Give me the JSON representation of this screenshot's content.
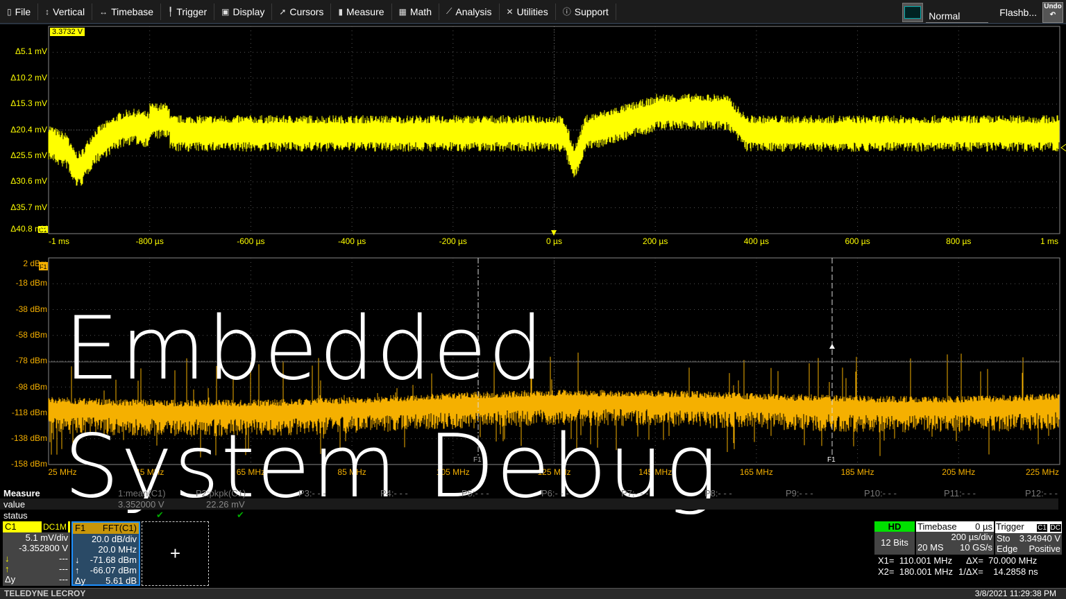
{
  "menu": [
    {
      "label": "File",
      "icon": "file-icon",
      "glyph": "▯"
    },
    {
      "label": "Vertical",
      "icon": "vertical-arrows-icon",
      "glyph": "↕"
    },
    {
      "label": "Timebase",
      "icon": "horizontal-arrows-icon",
      "glyph": "↔"
    },
    {
      "label": "Trigger",
      "icon": "trigger-icon",
      "glyph": "╿"
    },
    {
      "label": "Display",
      "icon": "display-icon",
      "glyph": "▣"
    },
    {
      "label": "Cursors",
      "icon": "cursor-icon",
      "glyph": "➚"
    },
    {
      "label": "Measure",
      "icon": "measure-icon",
      "glyph": "▮"
    },
    {
      "label": "Math",
      "icon": "calculator-icon",
      "glyph": "▦"
    },
    {
      "label": "Analysis",
      "icon": "chart-icon",
      "glyph": "⟋"
    },
    {
      "label": "Utilities",
      "icon": "tools-icon",
      "glyph": "✕"
    },
    {
      "label": "Support",
      "icon": "info-icon",
      "glyph": "ⓘ"
    }
  ],
  "toolbar": {
    "display_mode": "Normal",
    "flashback": "Flashb...",
    "undo": "Undo"
  },
  "colors": {
    "c1": "#ffff00",
    "f1": "#f5b000",
    "hd": "#00e000"
  },
  "top_plot": {
    "marker_value": "3.3732 V",
    "y_labels": [
      "Δ5.1 mV",
      "Δ10.2 mV",
      "Δ15.3 mV",
      "Δ20.4 mV",
      "Δ25.5 mV",
      "Δ30.6 mV",
      "Δ35.7 mV",
      "Δ40.8 mV"
    ],
    "x_labels": [
      "-1 ms",
      "-800 µs",
      "-600 µs",
      "-400 µs",
      "-200 µs",
      "0 µs",
      "200 µs",
      "400 µs",
      "600 µs",
      "800 µs",
      "1 ms"
    ],
    "channel_tag": "C1"
  },
  "bottom_plot": {
    "y_labels": [
      "2 dBm",
      "-18 dBm",
      "-38 dBm",
      "-58 dBm",
      "-78 dBm",
      "-98 dBm",
      "-118 dBm",
      "-138 dBm",
      "-158 dBm"
    ],
    "x_labels": [
      "25 MHz",
      "45 MHz",
      "65 MHz",
      "85 MHz",
      "105 MHz",
      "125 MHz",
      "145 MHz",
      "165 MHz",
      "185 MHz",
      "205 MHz",
      "225 MHz"
    ],
    "channel_tag": "F1",
    "cursor1_label": "F1",
    "cursor2_label": "F1"
  },
  "measure": {
    "title": "Measure",
    "row_value": "value",
    "row_status": "status",
    "params": [
      "1:mean(C1)",
      "P2:pkpk(C1)",
      "P3:- - -",
      "P4:- - -",
      "P5:- - -",
      "P6:- - -",
      "P7:- - -",
      "P8:- - -",
      "P9:- - -",
      "P10:- - -",
      "P11:- - -",
      "P12:- - -"
    ],
    "values": [
      "3.352000 V",
      "22.26 mV"
    ],
    "status": [
      "✔",
      "✔"
    ]
  },
  "c1": {
    "name": "C1",
    "coupling": "DC1M",
    "scale": "5.1 mV/div",
    "offset": "-3.352800 V",
    "down": "---",
    "up": "---",
    "dy": "---"
  },
  "f1": {
    "name": "F1",
    "func": "FFT(C1)",
    "scale": "20.0 dB/div",
    "span": "20.0 MHz",
    "down": "-71.68 dBm",
    "up": "-66.07 dBm",
    "dy": "5.61 dB"
  },
  "add_box": "+",
  "acq": {
    "hd": "HD",
    "bits": "12 Bits"
  },
  "timebase": {
    "title": "Timebase",
    "delay": "0 µs",
    "per_div": "200 µs/div",
    "samples": "20 MS",
    "rate": "10 GS/s"
  },
  "trigger": {
    "title": "Trigger",
    "src": "C1",
    "coupling": "DC",
    "mode": "Sto",
    "level": "3.34940 V",
    "type": "Edge",
    "slope": "Positive"
  },
  "cursors": {
    "x1": "X1=  110.001 MHz",
    "dx": "ΔX=  70.000 MHz",
    "x2": "X2=  180.001 MHz",
    "inv_dx": "1/ΔX=    14.2858 ns"
  },
  "footer": {
    "brand": "TELEDYNE LECROY",
    "datetime": "3/8/2021 11:29:38 PM"
  },
  "overlay": {
    "line1": "Embedded",
    "line2": "System Debug"
  }
}
